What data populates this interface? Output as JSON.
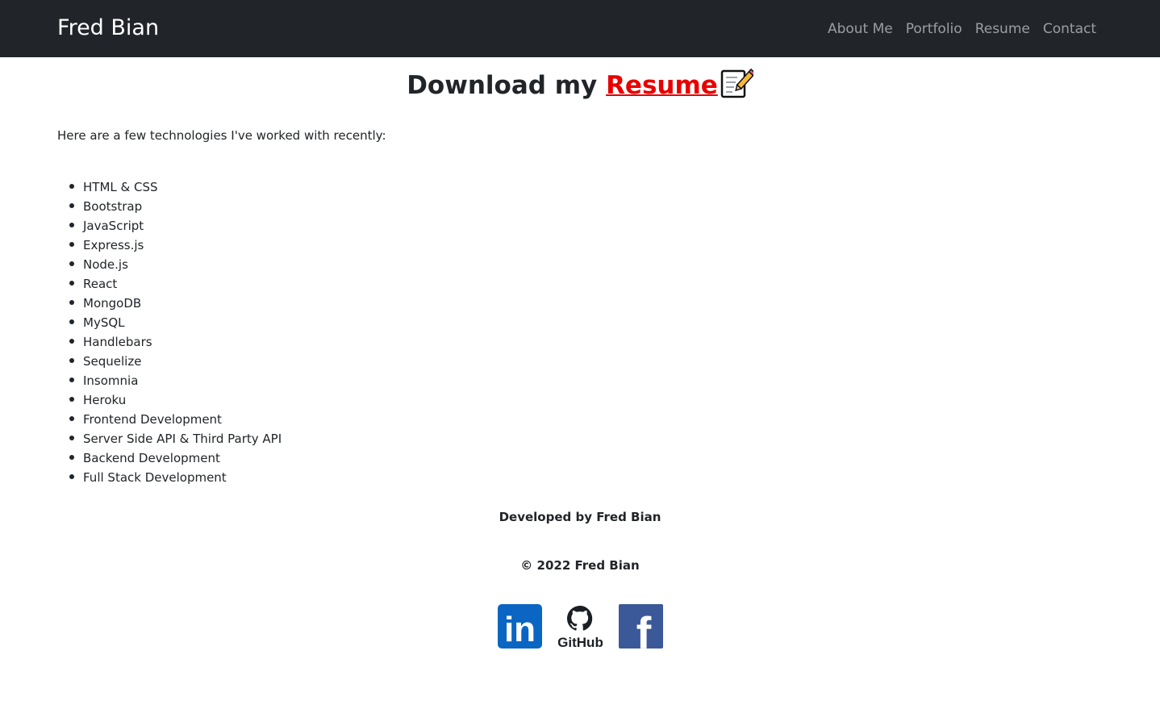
{
  "navbar": {
    "brand": "Fred Bian",
    "links": [
      "About Me",
      "Portfolio",
      "Resume",
      "Contact"
    ]
  },
  "download": {
    "prefix": "Download my ",
    "link_text": "Resume",
    "icon": "memo-icon"
  },
  "intro": "Here are a few technologies I've worked with recently:",
  "technologies": [
    "HTML & CSS",
    "Bootstrap",
    "JavaScript",
    "Express.js",
    "Node.js",
    "React",
    "MongoDB",
    "MySQL",
    "Handlebars",
    "Sequelize",
    "Insomnia",
    "Heroku",
    "Frontend Development",
    "Server Side API & Third Party API",
    "Backend Development",
    "Full Stack Development"
  ],
  "footer": {
    "developed_by": "Developed by Fred Bian",
    "copyright": "© 2022 Fred Bian",
    "socials": [
      {
        "name": "linkedin-icon",
        "label": "in",
        "color": "#0a66c2"
      },
      {
        "name": "github-icon",
        "label": "GitHub",
        "color": "#1b1f23"
      },
      {
        "name": "facebook-icon",
        "label": "f",
        "color": "#3b5998"
      }
    ]
  },
  "colors": {
    "navbar_bg": "#212529",
    "resume_link": "#e80000",
    "nav_link": "#9a9c9e"
  }
}
